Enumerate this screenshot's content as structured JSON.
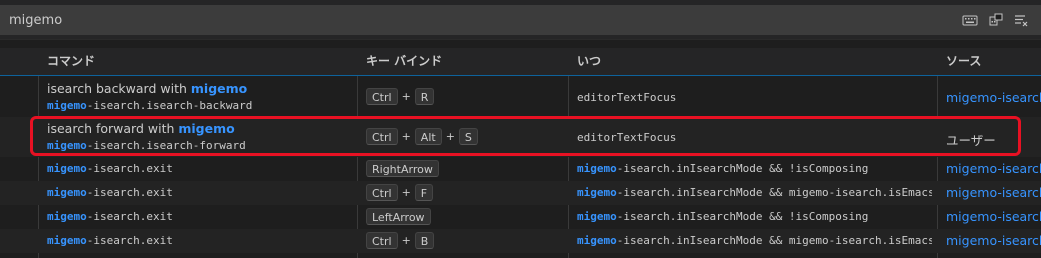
{
  "search": {
    "value": "migemo"
  },
  "toolbar": {
    "icons": [
      "keyboard-icon",
      "record-keys-icon",
      "sort-by-precedence-icon"
    ]
  },
  "header": {
    "command": "コマンド",
    "keybinding": "キー バインド",
    "when": "いつ",
    "source": "ソース"
  },
  "rows": [
    {
      "label_prefix": "isearch backward with ",
      "label_highlight": "migemo",
      "id_highlight": "migemo",
      "id_rest": "-isearch.isearch-backward",
      "keys": [
        "Ctrl",
        "R"
      ],
      "when_highlight": "",
      "when_rest": "editorTextFocus",
      "source": "migemo-isearch"
    },
    {
      "label_prefix": "isearch forward with ",
      "label_highlight": "migemo",
      "id_highlight": "migemo",
      "id_rest": "-isearch.isearch-forward",
      "keys": [
        "Ctrl",
        "Alt",
        "S"
      ],
      "when_highlight": "",
      "when_rest": "editorTextFocus",
      "source": "ユーザー"
    },
    {
      "id_highlight": "migemo",
      "id_rest": "-isearch.exit",
      "keys": [
        "RightArrow"
      ],
      "when_highlight": "migemo",
      "when_rest": "-isearch.inIsearchMode && !isComposing",
      "source": "migemo-isearch"
    },
    {
      "id_highlight": "migemo",
      "id_rest": "-isearch.exit",
      "keys": [
        "Ctrl",
        "F"
      ],
      "when_highlight": "migemo",
      "when_rest": "-isearch.inIsearchMode && migemo-isearch.isEmacs…",
      "source": "migemo-isearch"
    },
    {
      "id_highlight": "migemo",
      "id_rest": "-isearch.exit",
      "keys": [
        "LeftArrow"
      ],
      "when_highlight": "migemo",
      "when_rest": "-isearch.inIsearchMode && !isComposing",
      "source": "migemo-isearch"
    },
    {
      "id_highlight": "migemo",
      "id_rest": "-isearch.exit",
      "keys": [
        "Ctrl",
        "B"
      ],
      "when_highlight": "migemo",
      "when_rest": "-isearch.inIsearchMode && migemo-isearch.isEmacs…",
      "source": "migemo-isearch"
    }
  ],
  "colors": {
    "highlight": "#3794ff",
    "annotation_box": "#e81123",
    "background": "#1e1e1e"
  }
}
